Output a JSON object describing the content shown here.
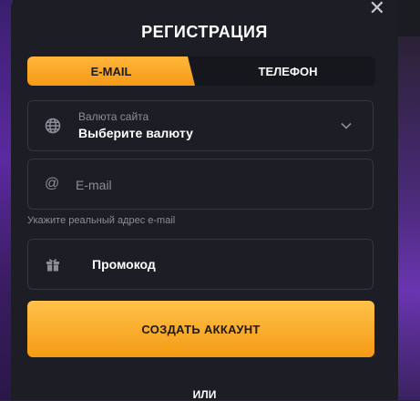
{
  "modal": {
    "title": "РЕГИСТРАЦИЯ",
    "close": "✕"
  },
  "tabs": [
    {
      "label": "E-MAIL",
      "active": true
    },
    {
      "label": "ТЕЛЕФОН",
      "active": false
    }
  ],
  "currency": {
    "label": "Валюта сайта",
    "value": "Выберите валюту",
    "icon": "globe-icon"
  },
  "email": {
    "placeholder": "E-mail",
    "value": "",
    "hint": "Укажите реальный адрес e-mail",
    "icon": "at-icon"
  },
  "promo": {
    "label": "Промокод",
    "icon": "gift-icon"
  },
  "actions": {
    "create_label": "СОЗДАТЬ АККАУНТ",
    "or_label": "ИЛИ"
  },
  "colors": {
    "accent": "#f7a823",
    "background": "#1d1e25",
    "field_border": "#34353e",
    "muted_text": "#8c8d97"
  }
}
